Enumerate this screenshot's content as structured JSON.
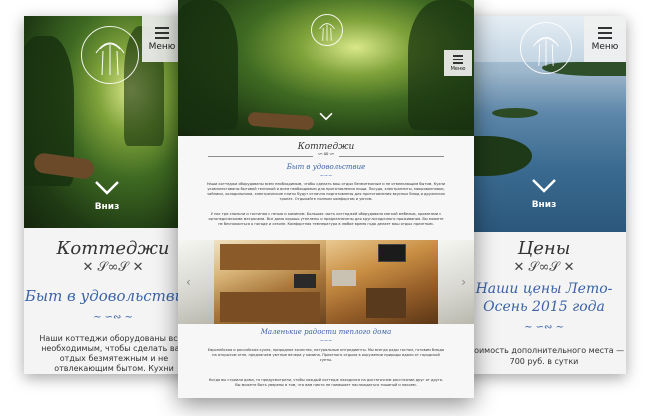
{
  "menu_label": "Меню",
  "down_label": "Вниз",
  "left": {
    "title": "Коттеджи",
    "subtitle": "Быт в удовольствие",
    "body": "Наши коттеджи оборудованы всем необходимым, чтобы сделать ваш отдых безмятежным и не отвлекающим бытом. Кухни укомплектованы бытовой техникой"
  },
  "center": {
    "title": "Коттеджи",
    "subtitle": "Быт в удовольствие",
    "para1": "Наши коттеджи оборудованы всем необходимым, чтобы сделать ваш отдых безмятежным и не отвлекающим бытом. Кухни укомплектованы бытовой техникой и всем необходимым для приготовления пищи. Посуда, электроплиты, микроволновки, чайники, холодильники, электрические плиты будут отлично подготовлены для приготовления вкусных блюд и дружеских трапез. Отдыхайте полным комфортом и уютом.",
    "para2": "У нас три спальни и гостиная с печью и камином. Большая часть коттеджей оборудована мягкой мебелью, кроватями с ортопедическими матрасами. Все дома хорошо утеплены и предназначены для круглогодичного проживания. Вы можете не беспокоиться о погоде и сезоне. Комфортная температура в любое время года делает ваш отдых приятным.",
    "subtitle2": "Маленькие радости теплого дома",
    "para3": "Европейская и российская кухня, природное качество, натуральные ингредиенты. Мы всегда рады гостям, готовим блюда на открытом огне, предлагаем уютные вечера у камина. Приятного отдыха в окружении природы вдали от городской суеты.",
    "para4": "Когда вы строили дома, то предусмотрели, чтобы каждый коттедж находился на достаточном расстоянии друг от друга. Вы можете быть уверены в том, что вам никто не помешает наслаждаться тишиной и покоем."
  },
  "right": {
    "title": "Цены",
    "subtitle": "Наши цены Лето-Осень 2015 года",
    "line1": "Стоимость дополнительного места —",
    "line2": "700 руб. в сутки"
  }
}
